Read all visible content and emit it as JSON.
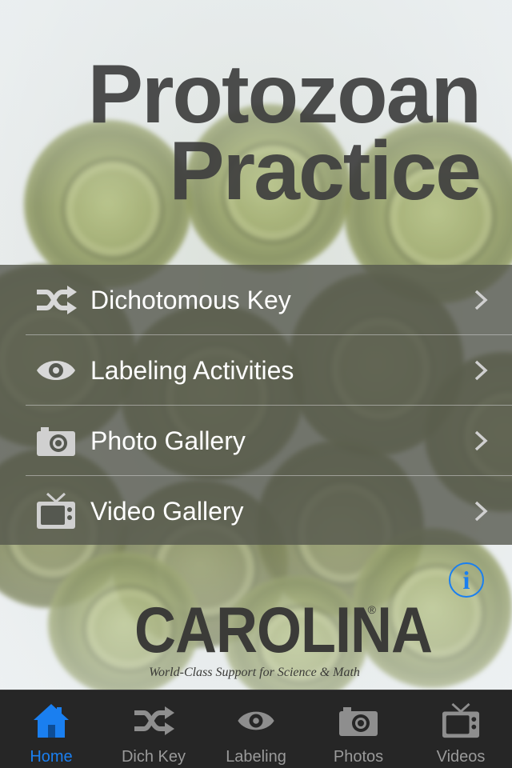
{
  "app": {
    "title_line1": "Protozoan",
    "title_line2": "Practice"
  },
  "menu": {
    "items": [
      {
        "label": "Dichotomous Key",
        "icon": "shuffle-icon"
      },
      {
        "label": "Labeling Activities",
        "icon": "eye-icon"
      },
      {
        "label": "Photo Gallery",
        "icon": "camera-icon"
      },
      {
        "label": "Video Gallery",
        "icon": "tv-icon"
      }
    ]
  },
  "info_button": {
    "glyph": "i"
  },
  "logo": {
    "wordmark": "CAROLINA",
    "registered": "®",
    "tagline": "World-Class Support for Science & Math"
  },
  "tabbar": {
    "active_color": "#1a7ff0",
    "inactive_color": "#9a9a9a",
    "tabs": [
      {
        "label": "Home",
        "icon": "home-icon",
        "active": true
      },
      {
        "label": "Dich Key",
        "icon": "shuffle-icon",
        "active": false
      },
      {
        "label": "Labeling",
        "icon": "eye-icon",
        "active": false
      },
      {
        "label": "Photos",
        "icon": "camera-icon",
        "active": false
      },
      {
        "label": "Videos",
        "icon": "tv-icon",
        "active": false
      }
    ]
  }
}
